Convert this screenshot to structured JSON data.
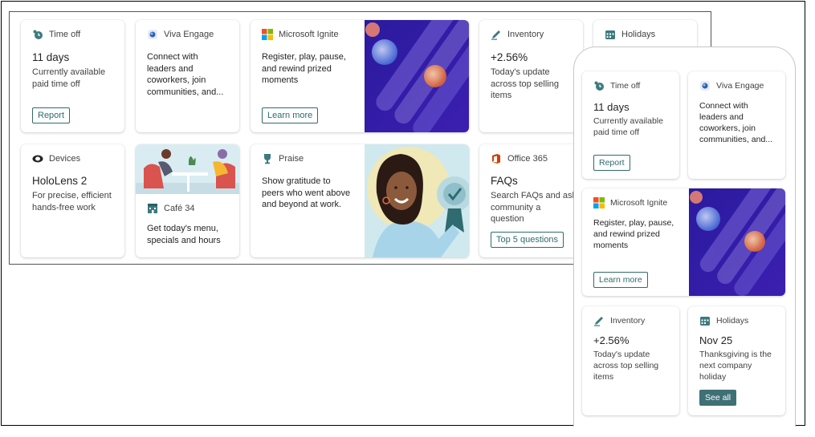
{
  "desktop": {
    "time_off": {
      "title": "Time off",
      "value": "11 days",
      "desc": [
        "Currently available",
        "paid time off"
      ],
      "button": "Report"
    },
    "viva": {
      "title": "Viva Engage",
      "desc": [
        "Connect with",
        "leaders and",
        "coworkers, join",
        "communities, and..."
      ]
    },
    "ignite": {
      "title": "Microsoft Ignite",
      "desc": [
        "Register, play, pause,",
        "and rewind prized",
        "moments"
      ],
      "button": "Learn more"
    },
    "inventory": {
      "title": "Inventory",
      "value": "+2.56%",
      "desc": [
        "Today's update",
        "across top selling",
        "items"
      ]
    },
    "holidays": {
      "title": "Holidays"
    },
    "devices": {
      "title": "Devices",
      "value": "HoloLens 2",
      "desc": [
        "For precise, efficient",
        "hands-free work"
      ]
    },
    "cafe": {
      "title": "Café 34",
      "desc": [
        "Get today's menu,",
        "specials and hours"
      ]
    },
    "praise": {
      "title": "Praise",
      "desc": [
        "Show gratitude to",
        "peers who went above",
        "and beyond at work."
      ]
    },
    "office": {
      "title": "Office 365",
      "value": "FAQs",
      "desc": [
        "Search FAQs and ask",
        "community a",
        "question"
      ],
      "button": "Top 5 questions"
    }
  },
  "mobile": {
    "time_off": {
      "title": "Time off",
      "value": "11 days",
      "desc": [
        "Currently available",
        "paid time off"
      ],
      "button": "Report"
    },
    "viva": {
      "title": "Viva Engage",
      "desc": [
        "Connect with",
        "leaders and",
        "coworkers, join",
        "communities, and..."
      ]
    },
    "ignite": {
      "title": "Microsoft Ignite",
      "desc": [
        "Register, play, pause,",
        "and rewind prized",
        "moments"
      ],
      "button": "Learn more"
    },
    "inventory": {
      "title": "Inventory",
      "value": "+2.56%",
      "desc": [
        "Today's update",
        "across top selling",
        "items"
      ]
    },
    "holidays": {
      "title": "Holidays",
      "value": "Nov 25",
      "desc": [
        "Thanksgiving is the",
        "next company",
        "holiday"
      ],
      "button": "See all"
    }
  },
  "colors": {
    "accent": "#2f6b70",
    "accent_fill": "#3e7075",
    "card_bg": "#ffffff",
    "purple": "#3a1fa0"
  },
  "icons": [
    "timer-icon",
    "viva-engage-icon",
    "microsoft-logo-icon",
    "pencil-icon",
    "calendar-icon",
    "devices-icon",
    "cafe-icon",
    "trophy-icon",
    "office-icon"
  ]
}
